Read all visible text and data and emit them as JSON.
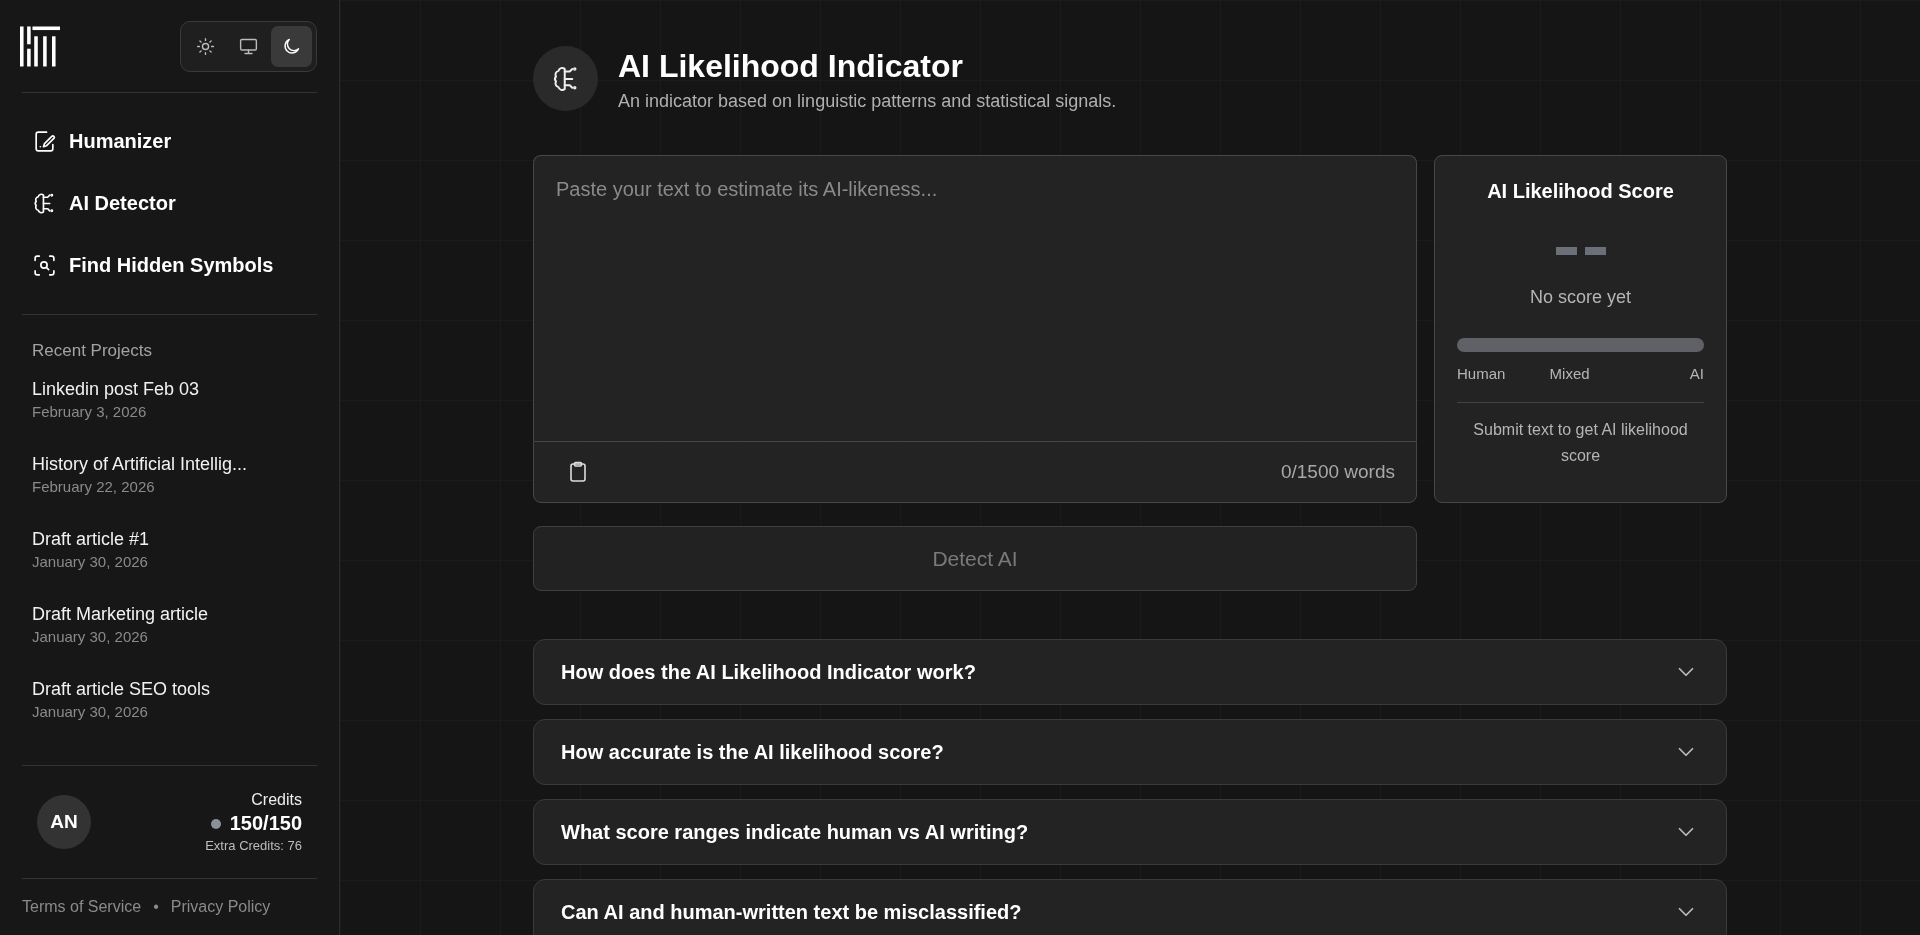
{
  "sidebar": {
    "theme_options": [
      {
        "selected": false
      },
      {
        "selected": false
      },
      {
        "selected": true
      }
    ],
    "nav": [
      {
        "label": "Humanizer"
      },
      {
        "label": "AI Detector"
      },
      {
        "label": "Find Hidden Symbols"
      }
    ],
    "recent_heading": "Recent Projects",
    "projects": [
      {
        "title": "Linkedin post Feb 03",
        "date": "February 3, 2026"
      },
      {
        "title": "History of Artificial Intellig...",
        "date": "February 22, 2026"
      },
      {
        "title": "Draft article #1",
        "date": "January 30, 2026"
      },
      {
        "title": "Draft Marketing article",
        "date": "January 30, 2026"
      },
      {
        "title": "Draft article SEO tools",
        "date": "January 30, 2026"
      }
    ],
    "user": {
      "initials": "AN"
    },
    "credits": {
      "label": "Credits",
      "value": "150/150",
      "extra": "Extra Credits: 76"
    },
    "footer_links": [
      "Terms of Service",
      "Privacy Policy"
    ],
    "footer_separator": "•"
  },
  "main": {
    "title": "AI Likelihood Indicator",
    "subtitle": "An indicator based on linguistic patterns and statistical signals.",
    "editor": {
      "placeholder": "Paste your text to estimate its AI-likeness...",
      "word_count": "0/1500 words"
    },
    "detect_button": {
      "label": "Detect AI",
      "disabled": true
    },
    "score_card": {
      "title": "AI Likelihood Score",
      "status": "No score yet",
      "scale_labels": [
        "Human",
        "Mixed",
        "AI"
      ],
      "hint": "Submit text to get AI likelihood score"
    },
    "faq": [
      {
        "question": "How does the AI Likelihood Indicator work?",
        "expanded": false
      },
      {
        "question": "How accurate is the AI likelihood score?",
        "expanded": false
      },
      {
        "question": "What score ranges indicate human vs AI writing?",
        "expanded": false
      },
      {
        "question": "Can AI and human-written text be misclassified?",
        "expanded": false
      }
    ]
  }
}
